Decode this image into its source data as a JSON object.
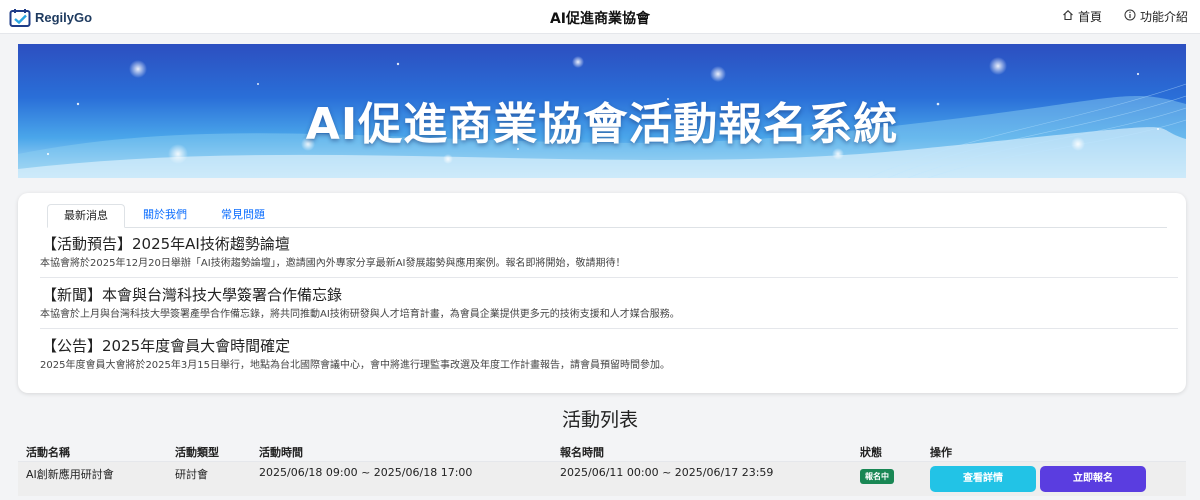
{
  "header": {
    "brand": "RegilyGo",
    "title": "AI促進商業協會",
    "nav": [
      {
        "icon": "home-icon",
        "label": "首頁"
      },
      {
        "icon": "info-icon",
        "label": "功能介紹"
      }
    ]
  },
  "banner": {
    "title": "AI促進商業協會活動報名系統"
  },
  "tabs": [
    "最新消息",
    "關於我們",
    "常見問題"
  ],
  "news": [
    {
      "title": "【活動預告】2025年AI技術趨勢論壇",
      "body": "本協會將於2025年12月20日舉辦「AI技術趨勢論壇」，邀請國內外專家分享最新AI發展趨勢與應用案例。報名即將開始，敬請期待！"
    },
    {
      "title": "【新聞】本會與台灣科技大學簽署合作備忘錄",
      "body": "本協會於上月與台灣科技大學簽署產學合作備忘錄，將共同推動AI技術研發與人才培育計畫，為會員企業提供更多元的技術支援和人才媒合服務。"
    },
    {
      "title": "【公告】2025年度會員大會時間確定",
      "body": "2025年度會員大會將於2025年3月15日舉行，地點為台北國際會議中心，會中將進行理監事改選及年度工作計畫報告，請會員預留時間參加。"
    }
  ],
  "activities": {
    "title": "活動列表",
    "columns": [
      "活動名稱",
      "活動類型",
      "活動時間",
      "報名時間",
      "狀態",
      "操作"
    ],
    "rows": [
      {
        "name": "AI創新應用研討會",
        "type": "研討會",
        "time": "2025/06/18 09:00 ~ 2025/06/18 17:00",
        "reg": "2025/06/11 00:00 ~ 2025/06/17 23:59",
        "status": "報名中",
        "detail": "查看詳情",
        "register": "立即報名"
      }
    ]
  },
  "colors": {
    "accent": "#5a3de0",
    "info": "#22c3e6",
    "status": "#198754",
    "link": "#0d6efd"
  }
}
